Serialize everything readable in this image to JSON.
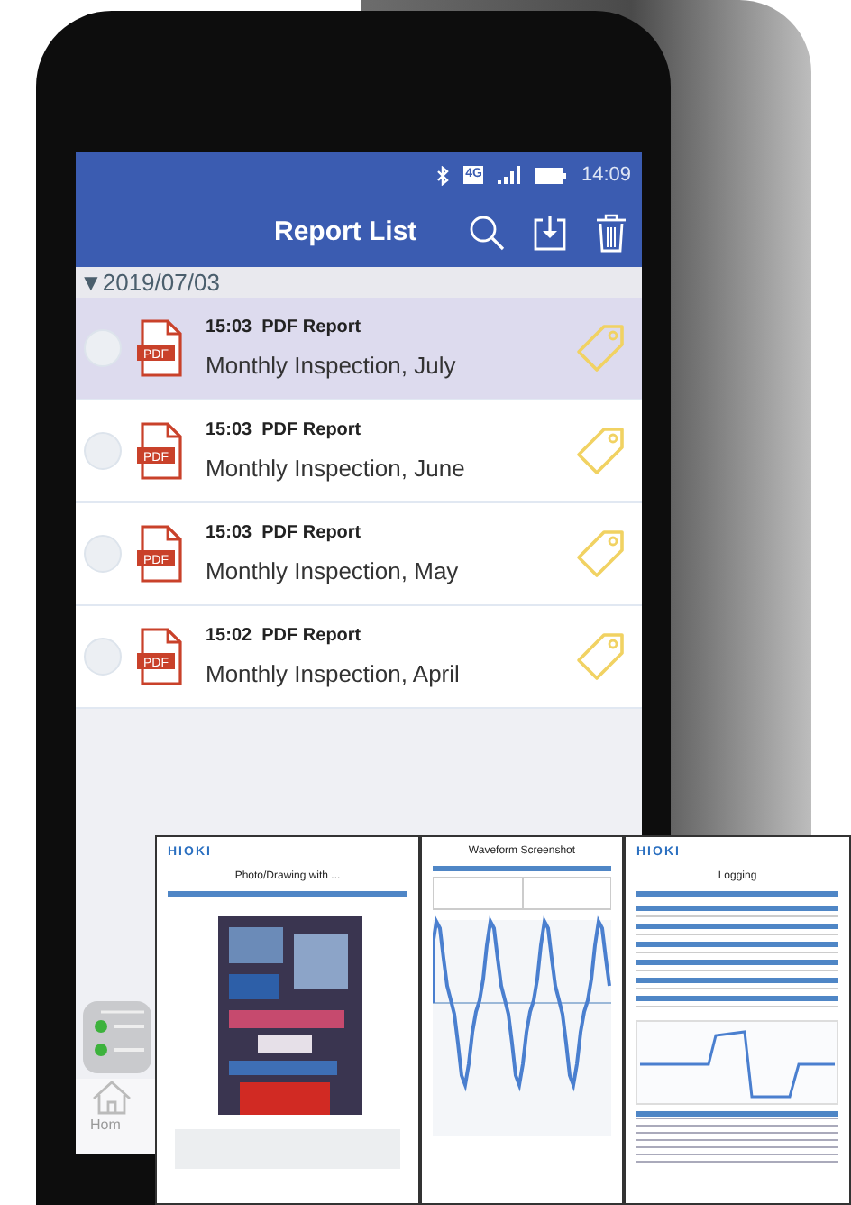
{
  "status_bar": {
    "network": "4G",
    "time": "14:09"
  },
  "header": {
    "title": "Report List"
  },
  "date_group": {
    "marker": "▼",
    "date": "2019/07/03"
  },
  "reports": [
    {
      "file_badge": "PDF",
      "time": "15:03",
      "type": "PDF Report",
      "name": "Monthly Inspection, July",
      "selected": true
    },
    {
      "file_badge": "PDF",
      "time": "15:03",
      "type": "PDF Report",
      "name": "Monthly Inspection, June",
      "selected": false
    },
    {
      "file_badge": "PDF",
      "time": "15:03",
      "type": "PDF Report",
      "name": "Monthly Inspection, May",
      "selected": false
    },
    {
      "file_badge": "PDF",
      "time": "15:02",
      "type": "PDF Report",
      "name": "Monthly Inspection, April",
      "selected": false
    }
  ],
  "bottom_nav": {
    "label": "Hom"
  },
  "report_pages": [
    {
      "logo": "HIOKI",
      "title": "Photo/Drawing with ..."
    },
    {
      "kind": "waveform",
      "title": "Waveform Screenshot"
    },
    {
      "kind": "logging",
      "logo": "HIOKI",
      "title": "Logging"
    }
  ]
}
